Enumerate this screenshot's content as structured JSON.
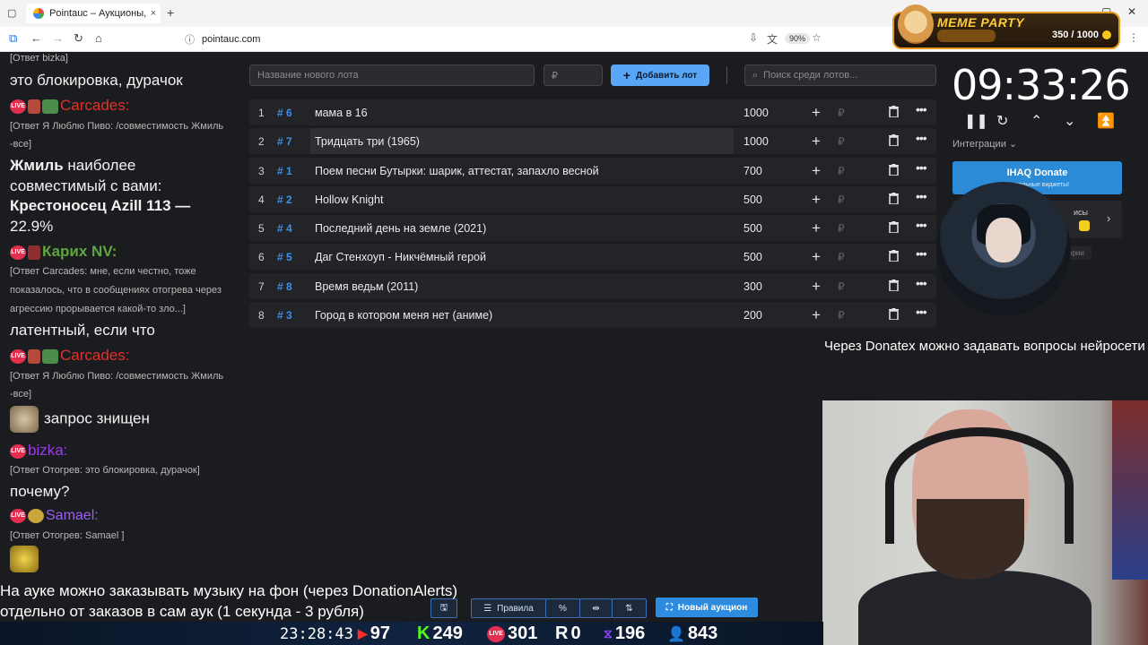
{
  "browser": {
    "tab_title": "Pointauc – Аукционы, лотереи",
    "url": "pointauc.com",
    "zoom": "90%"
  },
  "meme": {
    "title": "MEME PARTY",
    "count": "350 / 1000",
    "progress": 0.35
  },
  "chat": [
    {
      "type": "small",
      "text": "[Ответ bizka]"
    },
    {
      "type": "big",
      "text": "это блокировка, дурачок"
    },
    {
      "type": "user",
      "name": "Carcades:",
      "color": "red"
    },
    {
      "type": "small",
      "text": "[Ответ Я Люблю Пиво: /совместимость Жмиль"
    },
    {
      "type": "small",
      "text": "-все]"
    },
    {
      "type": "big",
      "bold": "Жмиль",
      "text": " наиболее"
    },
    {
      "type": "big",
      "text": "совместимый с вами:"
    },
    {
      "type": "bigbold",
      "text": "Крестоносец Azill 113 —"
    },
    {
      "type": "big",
      "text": "22.9%"
    },
    {
      "type": "user",
      "name": "Карих NV:",
      "color": "green"
    },
    {
      "type": "small",
      "text": "[Ответ Carcades: мне, если честно, тоже"
    },
    {
      "type": "small",
      "text": "показалось, что в сообщениях отогрева через"
    },
    {
      "type": "small",
      "text": "агрессию прорывается какой-то зло...]"
    },
    {
      "type": "big",
      "text": "латентный, если что"
    },
    {
      "type": "user",
      "name": "Carcades:",
      "color": "red"
    },
    {
      "type": "small",
      "text": "[Ответ Я Люблю Пиво: /совместимость Жмиль"
    },
    {
      "type": "small",
      "text": "-все]"
    },
    {
      "type": "emote",
      "text": "запрос знищен"
    },
    {
      "type": "user",
      "name": "bizka:",
      "color": "purple"
    },
    {
      "type": "small",
      "text": "[Ответ Отогрев: это блокировка, дурачок]"
    },
    {
      "type": "big",
      "text": "почему?"
    },
    {
      "type": "user",
      "name": "Samael:",
      "color": "violet"
    },
    {
      "type": "small",
      "text": "[Ответ Отогрев: Samael ]"
    }
  ],
  "toolbar": {
    "lot_name_placeholder": "Название нового лота",
    "amount_placeholder": "₽",
    "add_lot_label": "Добавить лот",
    "search_placeholder": "Поиск среди лотов..."
  },
  "lots": [
    {
      "n": "1",
      "id": "# 6",
      "name": "мама в 16",
      "amount": "1000"
    },
    {
      "n": "2",
      "id": "# 7",
      "name": "Тридцать три (1965)",
      "amount": "1000"
    },
    {
      "n": "3",
      "id": "# 1",
      "name": "Поем песни Бутырки: шарик, аттестат, запахло весной",
      "amount": "700"
    },
    {
      "n": "4",
      "id": "# 2",
      "name": "Hollow Knight",
      "amount": "500"
    },
    {
      "n": "5",
      "id": "# 4",
      "name": "Последний день на земле (2021)",
      "amount": "500"
    },
    {
      "n": "6",
      "id": "# 5",
      "name": "Даг Стенхоуп - Никчёмный герой",
      "amount": "500"
    },
    {
      "n": "7",
      "id": "# 8",
      "name": "Время ведьм (2011)",
      "amount": "300"
    },
    {
      "n": "8",
      "id": "# 3",
      "name": "Город в котором меня нет (аниме)",
      "amount": "200"
    }
  ],
  "lot_currency": "₽",
  "timer": "09:33:26",
  "integrations_label": "Интеграции",
  "donate": {
    "title": "IHAQ Donate",
    "subtitle": "уникальные виджеты!"
  },
  "services_label": "исы",
  "history_label": "ории",
  "notice": "Через Donatex можно задавать вопросы нейросети",
  "bottom_text": {
    "line1": "На ауке можно заказывать музыку на фон (через DonationAlerts)",
    "line2": "отдельно от заказов в сам аук (1 секунда - 3 рубля)"
  },
  "bottom_buttons": {
    "rules": "Правила",
    "new_auction": "Новый аукцион"
  },
  "stats": {
    "clock": "23:28:43",
    "youtube": "97",
    "kick": "249",
    "vk_live": "301",
    "rutube": "0",
    "twitch": "196",
    "viewers": "843"
  }
}
